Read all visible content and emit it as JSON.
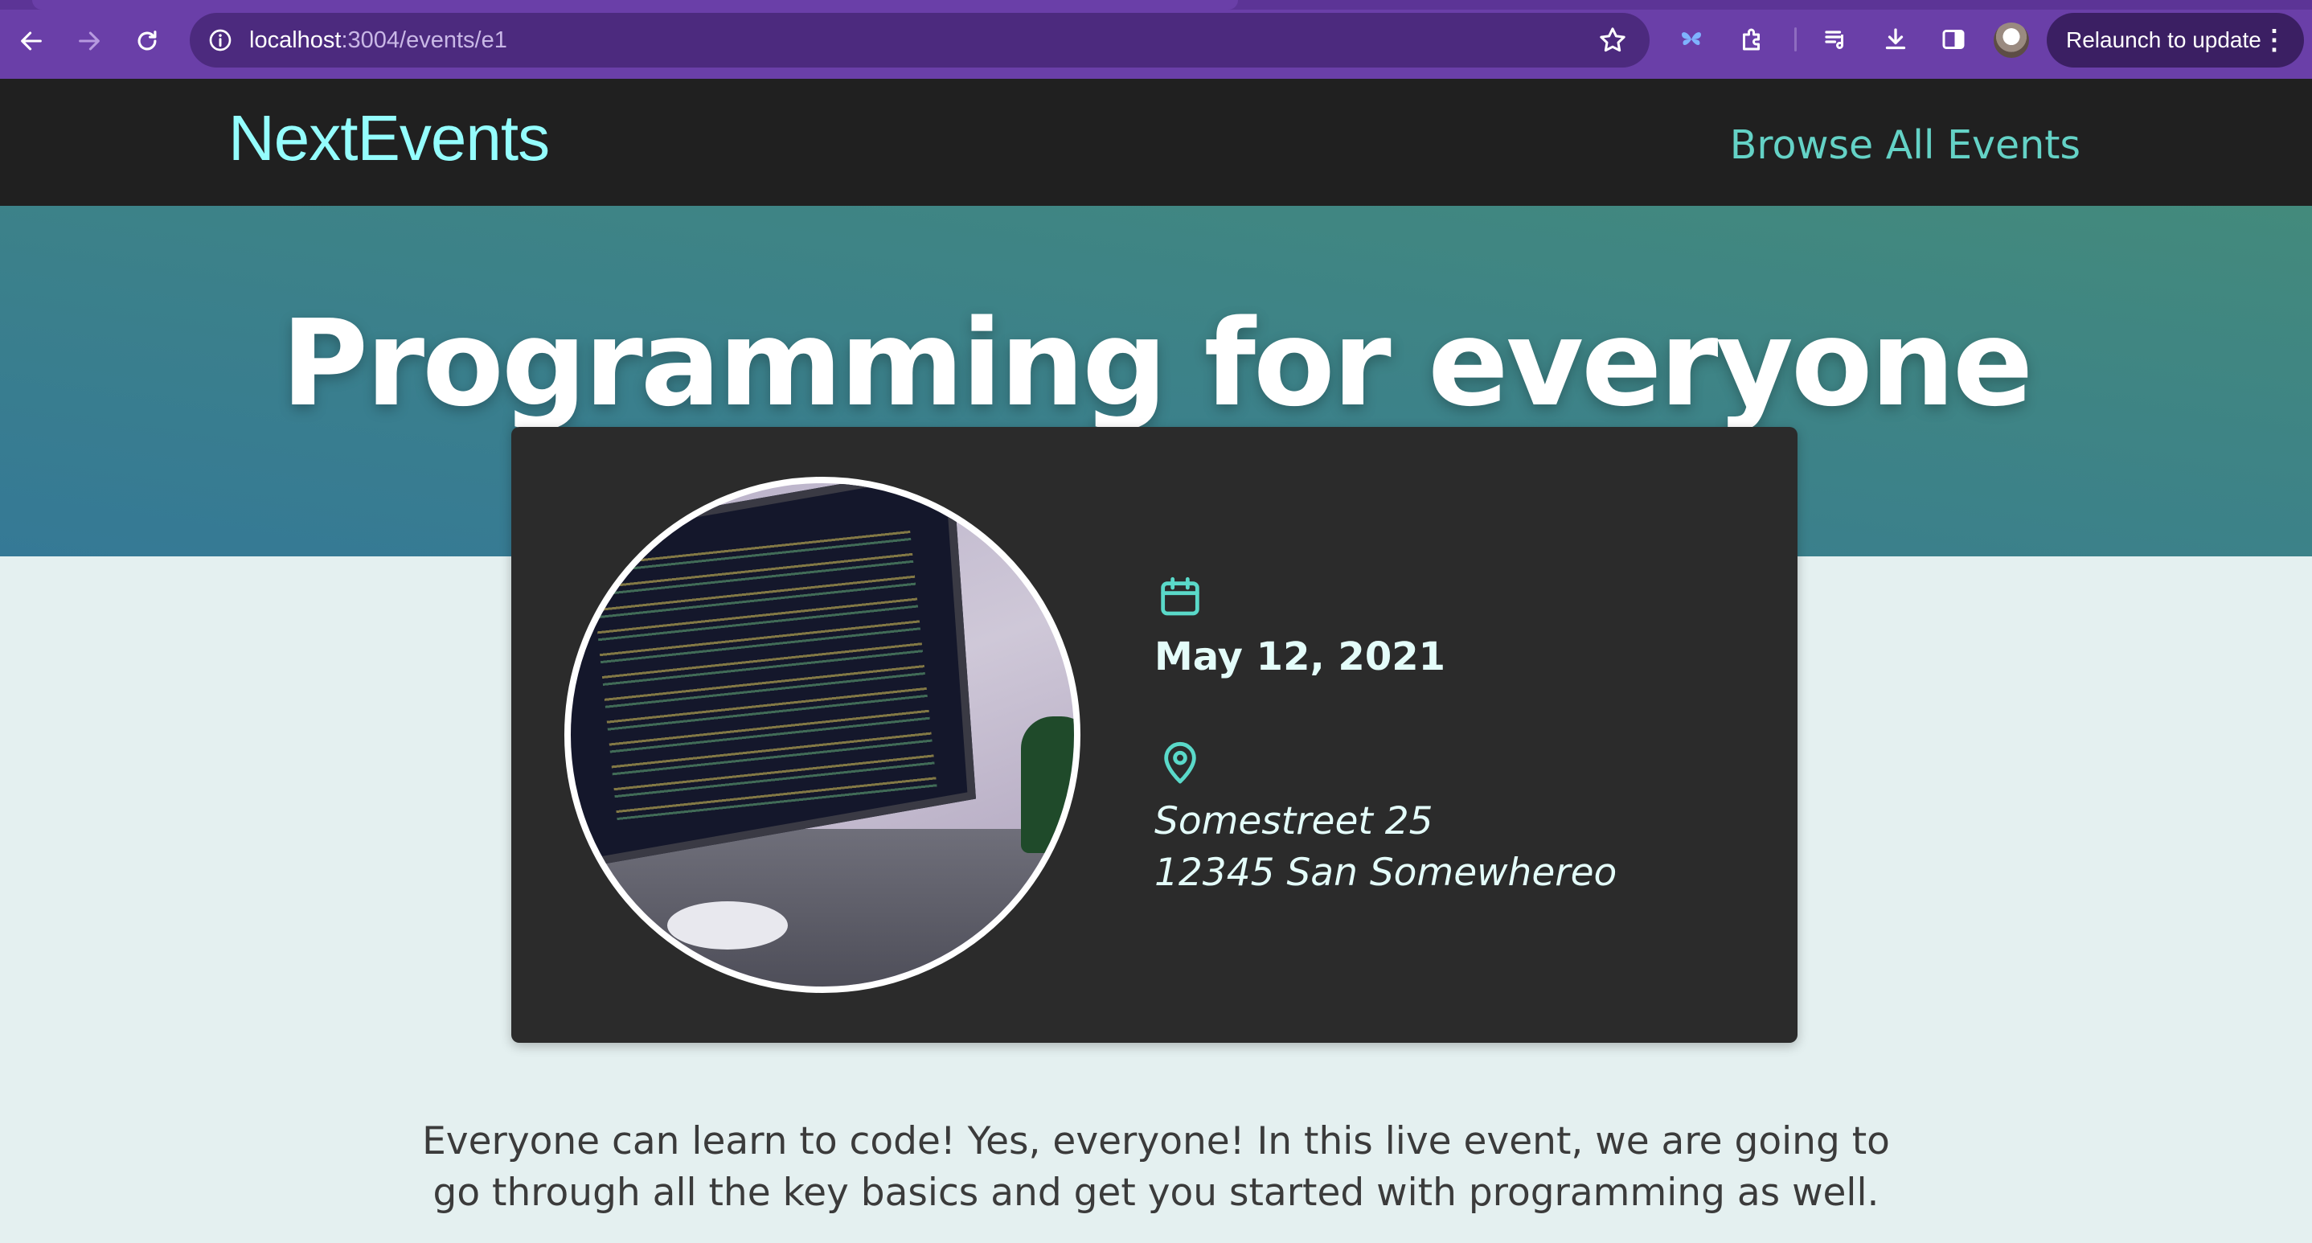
{
  "browser": {
    "url_host": "localhost",
    "url_path": ":3004/events/e1",
    "relaunch_label": "Relaunch to update",
    "menu_dots": "⋮"
  },
  "site": {
    "logo": "NextEvents",
    "nav_browse": "Browse All Events"
  },
  "event": {
    "title": "Programming for everyone",
    "date": "May 12, 2021",
    "address_line1": "Somestreet 25",
    "address_line2": "12345 San Somewhereo",
    "description": "Everyone can learn to code! Yes, everyone! In this live event, we are going to go through all the key basics and get you started with programming as well."
  },
  "colors": {
    "chrome": "#6a3fa8",
    "header_bg": "#202020",
    "logo": "#94fdfd",
    "nav_link": "#64d2c6",
    "hero_from": "#438a7c",
    "hero_to": "#357996",
    "card_bg": "#2b2b2b",
    "icon_accent": "#5ad9c9",
    "page_bg": "#e4f0f0"
  },
  "icons": {
    "back": "arrow-left-icon",
    "forward": "arrow-right-icon",
    "reload": "reload-icon",
    "site_info": "info-icon",
    "bookmark": "star-icon",
    "extensions": [
      "extension-puzzle-icon",
      "media-queue-icon",
      "download-icon",
      "side-panel-icon"
    ],
    "date": "calendar-icon",
    "location": "map-pin-icon"
  }
}
